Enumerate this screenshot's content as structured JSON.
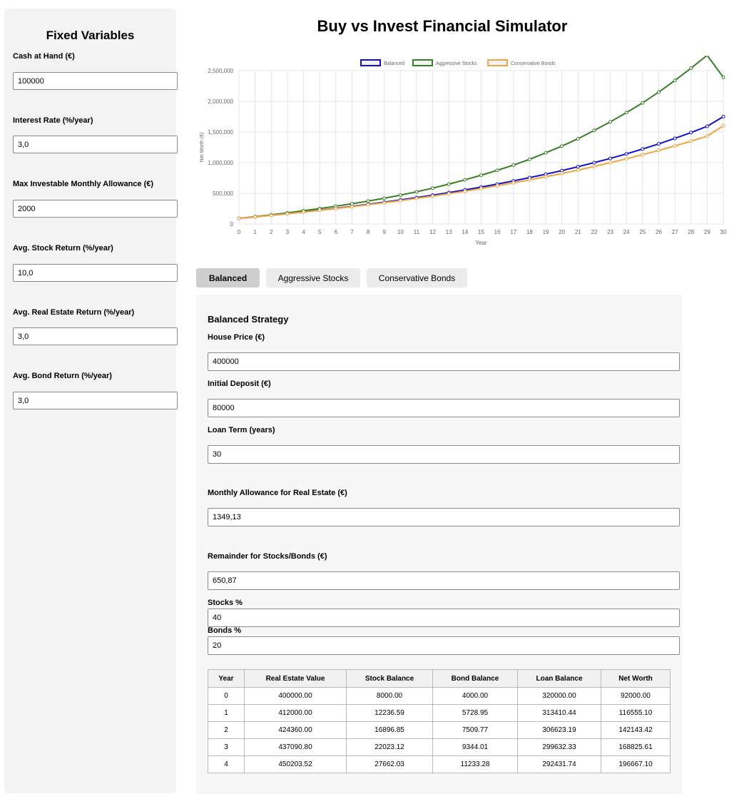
{
  "sidebar": {
    "title": "Fixed Variables",
    "fields": [
      {
        "label": "Cash at Hand (€)",
        "value": "100000"
      },
      {
        "label": "Interest Rate (%/year)",
        "value": "3,0"
      },
      {
        "label": "Max Investable Monthly Allowance (€)",
        "value": "2000"
      },
      {
        "label": "Avg. Stock Return (%/year)",
        "value": "10,0"
      },
      {
        "label": "Avg. Real Estate Return (%/year)",
        "value": "3,0"
      },
      {
        "label": "Avg. Bond Return (%/year)",
        "value": "3,0"
      }
    ]
  },
  "header": {
    "title": "Buy vs Invest Financial Simulator"
  },
  "chart_data": {
    "type": "line",
    "xlabel": "Year",
    "ylabel": "Net Worth (€)",
    "ylim": [
      0,
      2500000
    ],
    "yticks": [
      "0",
      "500,000",
      "1,000,000",
      "1,500,000",
      "2,000,000",
      "2,500,000"
    ],
    "x": [
      0,
      1,
      2,
      3,
      4,
      5,
      6,
      7,
      8,
      9,
      10,
      11,
      12,
      13,
      14,
      15,
      16,
      17,
      18,
      19,
      20,
      21,
      22,
      23,
      24,
      25,
      26,
      27,
      28,
      29,
      30
    ],
    "grid": true,
    "legend_position": "top",
    "series": [
      {
        "name": "Balanced",
        "color": "#1010cc",
        "values": [
          92000,
          116555,
          142143,
          168826,
          196667,
          225730,
          256090,
          287820,
          321000,
          355700,
          392000,
          430000,
          470000,
          512000,
          556000,
          602000,
          651000,
          702000,
          756000,
          812000,
          871000,
          934000,
          1000000,
          1069000,
          1143000,
          1222000,
          1306000,
          1396000,
          1491000,
          1593000,
          1750000
        ]
      },
      {
        "name": "Aggressive Stocks",
        "color": "#3a7d27",
        "values": [
          92000,
          120000,
          150000,
          182000,
          216000,
          252000,
          290000,
          330000,
          373000,
          420000,
          470000,
          525000,
          585000,
          650000,
          720000,
          795000,
          875000,
          960000,
          1055000,
          1160000,
          1270000,
          1390000,
          1525000,
          1665000,
          1815000,
          1975000,
          2150000,
          2340000,
          2540000,
          2750000,
          2390000
        ]
      },
      {
        "name": "Conservative Bonds",
        "color": "#f0a540",
        "values": [
          92000,
          116000,
          141000,
          167000,
          194000,
          222000,
          252000,
          282000,
          314000,
          347000,
          381000,
          417000,
          455000,
          494000,
          535000,
          578000,
          623000,
          670000,
          719000,
          770000,
          823000,
          879000,
          938000,
          999000,
          1063000,
          1130000,
          1200000,
          1273000,
          1350000,
          1432000,
          1600000
        ]
      }
    ]
  },
  "tabs": [
    "Balanced",
    "Aggressive Stocks",
    "Conservative Bonds"
  ],
  "strategy": {
    "title": "Balanced Strategy",
    "fields": [
      {
        "label": "House Price (€)",
        "value": "400000"
      },
      {
        "label": "Initial Deposit (€)",
        "value": "80000"
      },
      {
        "label": "Loan Term (years)",
        "value": "30"
      },
      {
        "label": "Monthly Allowance for Real Estate (€)",
        "value": "1349,13"
      },
      {
        "label": "Remainder for Stocks/Bonds (€)",
        "value": "650,87"
      },
      {
        "label": "Stocks %",
        "value": "40"
      },
      {
        "label": "Bonds %",
        "value": "20"
      }
    ]
  },
  "table": {
    "headers": [
      "Year",
      "Real Estate Value",
      "Stock Balance",
      "Bond Balance",
      "Loan Balance",
      "Net Worth"
    ],
    "rows": [
      [
        "0",
        "400000.00",
        "8000.00",
        "4000.00",
        "320000.00",
        "92000.00"
      ],
      [
        "1",
        "412000.00",
        "12236.59",
        "5728.95",
        "313410.44",
        "116555.10"
      ],
      [
        "2",
        "424360.00",
        "16896.85",
        "7509.77",
        "306623.19",
        "142143.42"
      ],
      [
        "3",
        "437090.80",
        "22023.12",
        "9344.01",
        "299632.33",
        "168825.61"
      ],
      [
        "4",
        "450203.52",
        "27662.03",
        "11233.28",
        "292431.74",
        "196667.10"
      ]
    ]
  }
}
